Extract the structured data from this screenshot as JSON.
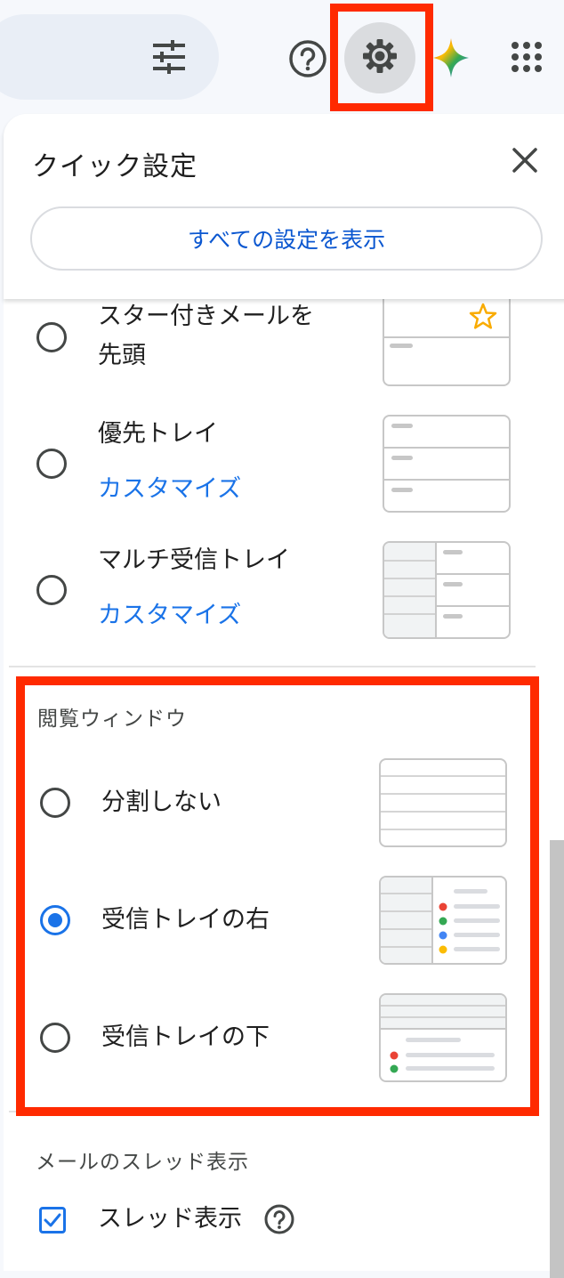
{
  "topbar": {
    "tune_icon": "tune-icon",
    "help_icon": "help-circle-icon",
    "settings_icon": "gear-icon",
    "gemini_icon": "gemini-sparkle-icon",
    "apps_icon": "apps-grid-icon"
  },
  "quick_settings": {
    "title": "クイック設定",
    "close_icon": "close-icon",
    "all_settings_label": "すべての設定を表示"
  },
  "inbox_types": [
    {
      "label_line1": "スター付きメールを",
      "label_line2": "先頭",
      "selected": false
    },
    {
      "label": "優先トレイ",
      "link": "カスタマイズ",
      "selected": false
    },
    {
      "label": "マルチ受信トレイ",
      "link": "カスタマイズ",
      "selected": false
    }
  ],
  "reading_pane": {
    "title": "閲覧ウィンドウ",
    "options": [
      {
        "label": "分割しない",
        "selected": false
      },
      {
        "label": "受信トレイの右",
        "selected": true
      },
      {
        "label": "受信トレイの下",
        "selected": false
      }
    ]
  },
  "threading": {
    "title": "メールのスレッド表示",
    "checkbox_label": "スレッド表示",
    "checked": true,
    "help_icon": "help-circle-icon"
  },
  "colors": {
    "highlight": "#ff2a00",
    "accent_blue": "#1a73e8",
    "link_blue": "#0b57d0",
    "star_yellow": "#f9ab00",
    "dot_red": "#ea4335",
    "dot_green": "#34a853",
    "dot_blue": "#4285f4",
    "dot_orange": "#fbbc04"
  }
}
